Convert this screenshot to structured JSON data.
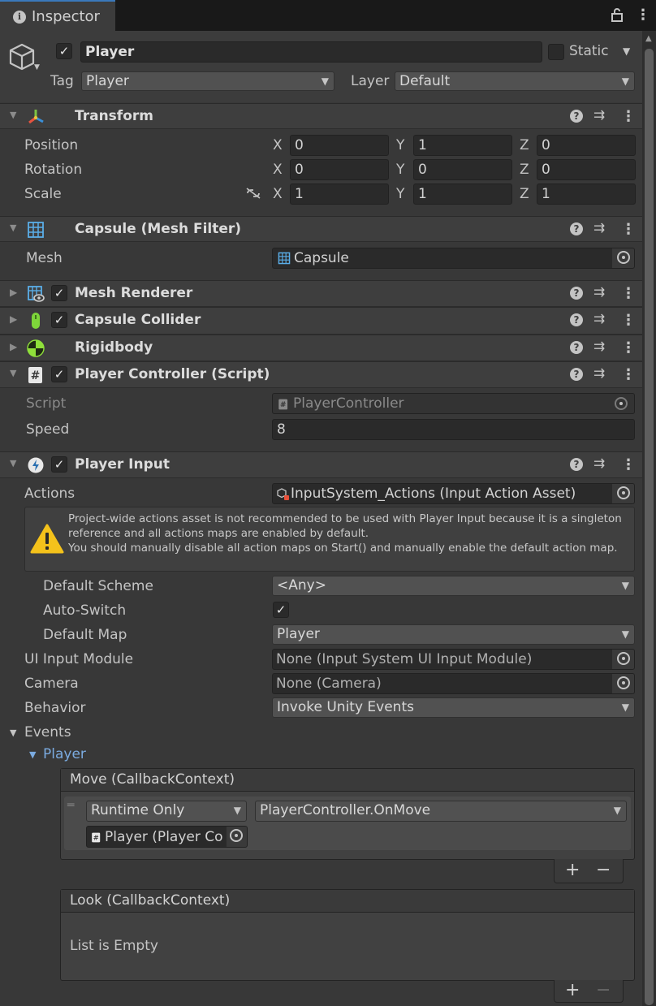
{
  "tab": {
    "title": "Inspector"
  },
  "object": {
    "name": "Player",
    "static_label": "Static",
    "tag_label": "Tag",
    "tag_value": "Player",
    "layer_label": "Layer",
    "layer_value": "Default"
  },
  "transform": {
    "title": "Transform",
    "rows": [
      {
        "label": "Position",
        "x": "0",
        "y": "1",
        "z": "0"
      },
      {
        "label": "Rotation",
        "x": "0",
        "y": "0",
        "z": "0"
      },
      {
        "label": "Scale",
        "x": "1",
        "y": "1",
        "z": "1"
      }
    ],
    "axis_x": "X",
    "axis_y": "Y",
    "axis_z": "Z"
  },
  "mesh_filter": {
    "title": "Capsule (Mesh Filter)",
    "mesh_label": "Mesh",
    "mesh_value": "Capsule"
  },
  "mesh_renderer": {
    "title": "Mesh Renderer"
  },
  "capsule_collider": {
    "title": "Capsule Collider"
  },
  "rigidbody": {
    "title": "Rigidbody"
  },
  "player_controller": {
    "title": "Player Controller (Script)",
    "script_label": "Script",
    "script_value": "PlayerController",
    "speed_label": "Speed",
    "speed_value": "8"
  },
  "player_input": {
    "title": "Player Input",
    "actions_label": "Actions",
    "actions_value": "InputSystem_Actions (Input Action Asset)",
    "warning": "Project-wide actions asset is not recommended to be used with Player Input because it is a singleton reference and all actions maps are enabled by default.\nYou should manually disable all action maps on Start() and manually enable the default action map.",
    "default_scheme_label": "Default Scheme",
    "default_scheme_value": "<Any>",
    "auto_switch_label": "Auto-Switch",
    "default_map_label": "Default Map",
    "default_map_value": "Player",
    "ui_input_module_label": "UI Input Module",
    "ui_input_module_value": "None (Input System UI Input Module)",
    "camera_label": "Camera",
    "camera_value": "None (Camera)",
    "behavior_label": "Behavior",
    "behavior_value": "Invoke Unity Events",
    "events_label": "Events",
    "player_map_label": "Player",
    "move_event": {
      "title": "Move (CallbackContext)",
      "runtime": "Runtime Only",
      "function": "PlayerController.OnMove",
      "target": "Player (Player Co"
    },
    "look_event": {
      "title": "Look (CallbackContext)",
      "empty": "List is Empty"
    },
    "plus": "+",
    "minus": "−"
  },
  "colors": {
    "accent": "#3a79bb",
    "link_blue": "#7babe0",
    "warning_yellow": "#f4c21b"
  }
}
